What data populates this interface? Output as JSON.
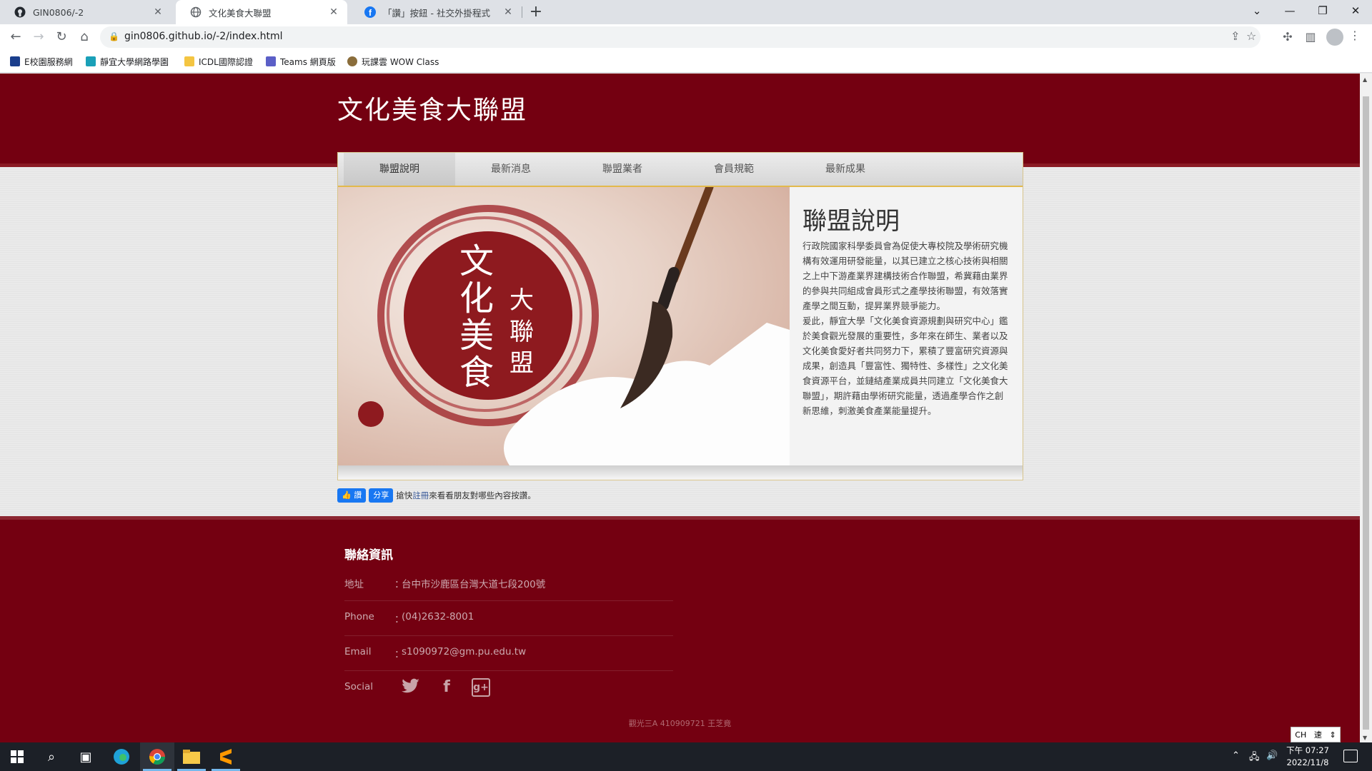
{
  "browser": {
    "tabs": [
      {
        "title": "GIN0806/-2",
        "icon": "github-icon"
      },
      {
        "title": "文化美食大聯盟",
        "icon": "globe-icon"
      },
      {
        "title": "「讚」按鈕 - 社交外掛程式",
        "icon": "facebook-icon"
      }
    ],
    "active_tab": 1,
    "url": "gin0806.github.io/-2/index.html",
    "bookmarks": [
      {
        "label": "E校園服務網",
        "color": "#1a3e8c"
      },
      {
        "label": "靜宜大學網路學園",
        "color": "#1aa0b8"
      },
      {
        "label": "ICDL國際認證",
        "color": "#f4c542"
      },
      {
        "label": "Teams 網頁版",
        "color": "#5b5fc7"
      },
      {
        "label": "玩課雲 WOW Class",
        "color": "#8a6d3b"
      }
    ]
  },
  "site": {
    "title": "文化美食大聯盟",
    "nav": [
      "聯盟說明",
      "最新消息",
      "聯盟業者",
      "會員規範",
      "最新成果"
    ],
    "active_nav": 0,
    "hero": {
      "logo_line1": "文化美食",
      "logo_line2": "大聯盟"
    },
    "intro": {
      "title": "聯盟說明",
      "paragraphs": [
        "行政院國家科學委員會為促使大專校院及學術研究機構有效運用研發能量，以其已建立之核心技術與相關之上中下游產業界建構技術合作聯盟，希冀藉由業界的參與共同組成會員形式之產學技術聯盟，有效落實產學之間互動，提昇業界競爭能力。",
        "爰此，靜宜大學「文化美食資源規劃與研究中心」鑑於美食觀光發展的重要性，多年來在師生、業者以及文化美食愛好者共同努力下，累積了豐富研究資源與成果，創造具「豐富性、獨特性、多樣性」之文化美食資源平台，並鏈結產業成員共同建立「文化美食大聯盟」，期許藉由學術研究能量，透過產學合作之創新思維，刺激美食產業能量提升。"
      ]
    },
    "facebook": {
      "like": "讚",
      "share": "分享",
      "pre": "搶快",
      "link": "註冊",
      "post": "來看看朋友對哪些內容按讚。"
    },
    "footer": {
      "heading": "聯絡資訊",
      "rows": [
        {
          "label": "地址",
          "value": "台中市沙鹿區台灣大道七段200號"
        },
        {
          "label": "Phone",
          "value": "(04)2632-8001"
        },
        {
          "label": "Email",
          "value": "s1090972@gm.pu.edu.tw"
        }
      ],
      "social_label": "Social",
      "social_icons": [
        "twitter-icon",
        "facebook-icon",
        "google-plus-icon"
      ],
      "colon": "：",
      "credit": "觀光三A 410909721 王芝竟"
    }
  },
  "system": {
    "ime_lang": "CH",
    "ime_mode": "速",
    "time": "下午 07:27",
    "date": "2022/11/8"
  },
  "colors": {
    "brand": "#740011",
    "accent": "#e2b94c"
  }
}
